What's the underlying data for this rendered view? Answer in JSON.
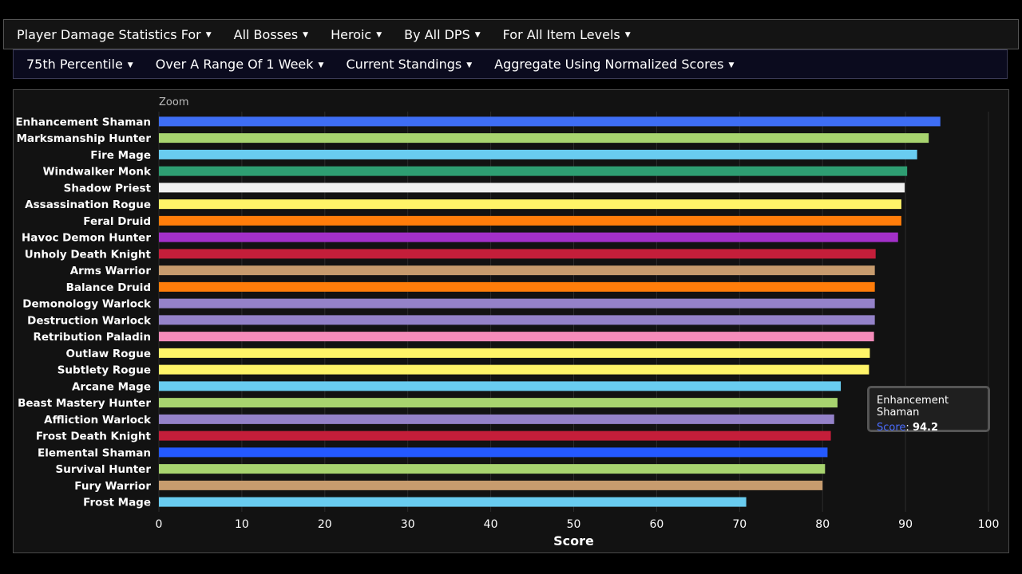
{
  "filters_row1": [
    {
      "label": "Player Damage Statistics For"
    },
    {
      "label": "All Bosses"
    },
    {
      "label": "Heroic"
    },
    {
      "label": "By All DPS"
    },
    {
      "label": "For All Item Levels"
    }
  ],
  "filters_row2": [
    {
      "label": "75th Percentile"
    },
    {
      "label": "Over A Range Of 1 Week"
    },
    {
      "label": "Current Standings"
    },
    {
      "label": "Aggregate Using Normalized Scores"
    }
  ],
  "zoom_label": "Zoom",
  "tooltip": {
    "title": "Enhancement Shaman",
    "key": "Score",
    "value": "94.2"
  },
  "chart_data": {
    "type": "bar",
    "orientation": "horizontal",
    "xlabel": "Score",
    "xlim": [
      0,
      100
    ],
    "xticks": [
      0,
      10,
      20,
      30,
      40,
      50,
      60,
      70,
      80,
      90,
      100
    ],
    "grid": true,
    "categories": [
      "Enhancement Shaman",
      "Marksmanship Hunter",
      "Fire Mage",
      "Windwalker Monk",
      "Shadow Priest",
      "Assassination Rogue",
      "Feral Druid",
      "Havoc Demon Hunter",
      "Unholy Death Knight",
      "Arms Warrior",
      "Balance Druid",
      "Demonology Warlock",
      "Destruction Warlock",
      "Retribution Paladin",
      "Outlaw Rogue",
      "Subtlety Rogue",
      "Arcane Mage",
      "Beast Mastery Hunter",
      "Affliction Warlock",
      "Frost Death Knight",
      "Elemental Shaman",
      "Survival Hunter",
      "Fury Warrior",
      "Frost Mage"
    ],
    "values": [
      94.2,
      92.8,
      91.4,
      90.2,
      89.9,
      89.5,
      89.5,
      89.1,
      86.4,
      86.3,
      86.3,
      86.3,
      86.3,
      86.2,
      85.7,
      85.6,
      82.2,
      81.8,
      81.4,
      81.0,
      80.6,
      80.3,
      80.0,
      70.8
    ],
    "colors": [
      "#3e6ef5",
      "#a8d46f",
      "#69ccf0",
      "#2e9e72",
      "#f0f0f0",
      "#fff468",
      "#ff7d0a",
      "#a330c9",
      "#c41e3a",
      "#c79c6e",
      "#ff7d0a",
      "#9482c9",
      "#9482c9",
      "#f58cba",
      "#fff468",
      "#fff468",
      "#69ccf0",
      "#a8d46f",
      "#9482c9",
      "#c41e3a",
      "#2459ff",
      "#a8d46f",
      "#c79c6e",
      "#69ccf0"
    ]
  }
}
